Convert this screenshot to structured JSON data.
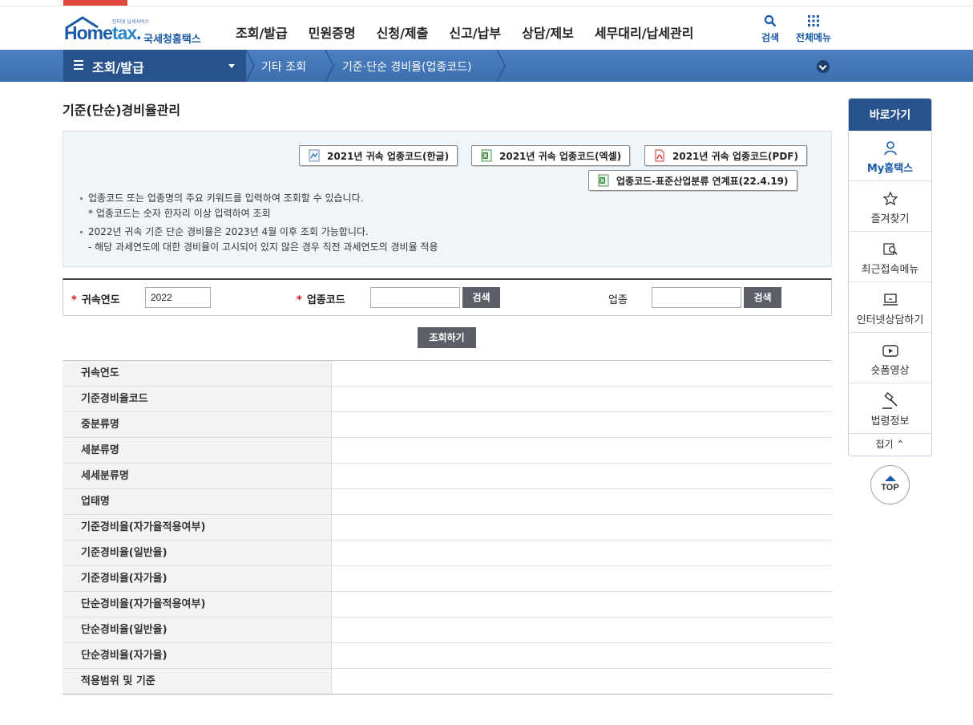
{
  "util": {
    "tab": ""
  },
  "header": {
    "logo": {
      "small": "인터넷 납세서비스",
      "brand_home": "Home",
      "brand_tax": "tax",
      "korean": "국세청홈택스"
    },
    "gnb": [
      "조회/발급",
      "민원증명",
      "신청/제출",
      "신고/납부",
      "상담/제보",
      "세무대리/납세관리"
    ],
    "search_label": "검색",
    "allmenu_label": "전체메뉴"
  },
  "navbar": {
    "title": "조회/발급",
    "crumbs": [
      "기타 조회",
      "기준·단순 경비율(업종코드)"
    ]
  },
  "page_title": "기준(단순)경비율관리",
  "downloads": [
    {
      "label": "2021년 귀속 업종코드(한글)",
      "icon": "hwp-file-icon"
    },
    {
      "label": "2021년 귀속 업종코드(엑셀)",
      "icon": "excel-file-icon"
    },
    {
      "label": "2021년 귀속 업종코드(PDF)",
      "icon": "pdf-file-icon"
    },
    {
      "label": "업종코드-표준산업분류 연계표(22.4.19)",
      "icon": "excel-file-icon"
    }
  ],
  "notes": {
    "n1": "업종코드 또는 업종명의 주요 키워드를 입력하여 조회할 수 있습니다.",
    "n1s": "* 업종코드는 숫자 한자리 이상 입력하여 조회",
    "n2": "2022년 귀속 기준 단순 경비율은 2023년 4월 이후 조회 가능합니다.",
    "n2s": "- 해당 과세연도에 대한 경비율이 고시되어 있지 않은 경우 직전 과세연도의 경비율 적용"
  },
  "form": {
    "year_label": "귀속연도",
    "year_value": "2022",
    "code_label": "업종코드",
    "code_value": "",
    "biz_label": "업종",
    "biz_value": "",
    "required_mark": "*",
    "search_btn": "검색",
    "query_btn": "조회하기"
  },
  "result_rows": [
    "귀속연도",
    "기준경비율코드",
    "중분류명",
    "세분류명",
    "세세분류명",
    "업태명",
    "기준경비율(자가율적용여부)",
    "기준경비율(일반율)",
    "기준경비율(자가율)",
    "단순경비율(자가율적용여부)",
    "단순경비율(일반율)",
    "단순경비율(자가율)",
    "적용범위 및 기준"
  ],
  "quick": {
    "title": "바로가기",
    "items": [
      "My홈택스",
      "즐겨찾기",
      "최근접속메뉴",
      "인터넷상담하기",
      "숏폼영상",
      "법령정보"
    ],
    "fold": "접기",
    "top": "TOP"
  },
  "colors": {
    "brand": "#1b5aa8",
    "nav": "#3d6fae",
    "nav_dark": "#27528c",
    "button": "#5b6068",
    "required": "#dd1111"
  }
}
